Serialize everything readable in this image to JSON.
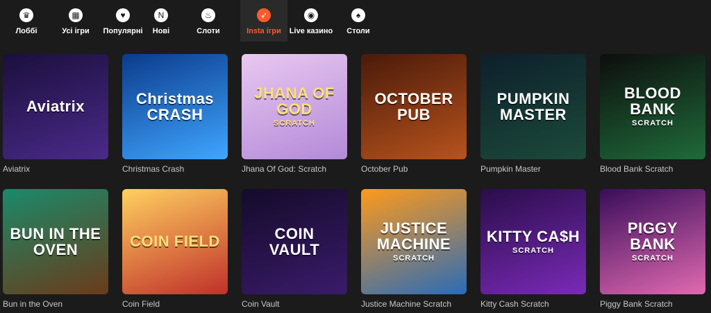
{
  "nav": {
    "items": [
      {
        "label": "Лоббі",
        "icon": "crown-icon",
        "active": false
      },
      {
        "label": "Усі ігри",
        "icon": "grid-icon",
        "active": false
      },
      {
        "label": "Популярні",
        "icon": "heart-icon",
        "active": false
      },
      {
        "label": "Нові",
        "icon": "new-icon",
        "active": false
      },
      {
        "label": "Слоти",
        "icon": "flame-icon",
        "active": false
      },
      {
        "label": "Insta ігри",
        "icon": "rocket-icon",
        "active": true
      },
      {
        "label": "Live казино",
        "icon": "live-icon",
        "active": false
      },
      {
        "label": "Столи",
        "icon": "spade-icon",
        "active": false
      }
    ],
    "active_color": "#ff5a2a"
  },
  "games": [
    {
      "title": "Aviatrix",
      "art": "Aviatrix",
      "art_sub": "",
      "colors": [
        "#1b0f3d",
        "#4a2a8a"
      ]
    },
    {
      "title": "Christmas Crash",
      "art": "Christmas CRASH",
      "art_sub": "",
      "colors": [
        "#0b3b8c",
        "#3fa6ff"
      ]
    },
    {
      "title": "Jhana Of God: Scratch",
      "art": "JHANA OF GOD",
      "art_sub": "SCRATCH",
      "colors": [
        "#e9c8f0",
        "#b28ad8"
      ]
    },
    {
      "title": "October Pub",
      "art": "OCTOBER PUB",
      "art_sub": "",
      "colors": [
        "#4a1a0a",
        "#b8531c"
      ]
    },
    {
      "title": "Pumpkin Master",
      "art": "PUMPKIN MASTER",
      "art_sub": "",
      "colors": [
        "#0d1f2b",
        "#1c4a3a"
      ]
    },
    {
      "title": "Blood Bank Scratch",
      "art": "BLOOD BANK",
      "art_sub": "SCRATCH",
      "colors": [
        "#0d0d0d",
        "#1f6b3a"
      ]
    },
    {
      "title": "Bun in the Oven",
      "art": "BUN IN THE OVEN",
      "art_sub": "",
      "colors": [
        "#1a8a6a",
        "#6a3b1a"
      ]
    },
    {
      "title": "Coin Field",
      "art": "COIN FIELD",
      "art_sub": "",
      "colors": [
        "#ffd060",
        "#c0302a"
      ]
    },
    {
      "title": "Coin Vault",
      "art": "COIN VAULT",
      "art_sub": "",
      "colors": [
        "#140b2a",
        "#3a1b6a"
      ]
    },
    {
      "title": "Justice Machine Scratch",
      "art": "JUSTICE MACHINE",
      "art_sub": "SCRATCH",
      "colors": [
        "#ff9a1a",
        "#2a6bb8"
      ]
    },
    {
      "title": "Kitty Cash Scratch",
      "art": "KITTY CA$H",
      "art_sub": "SCRATCH",
      "colors": [
        "#2a0d4a",
        "#7a2ab8"
      ]
    },
    {
      "title": "Piggy Bank Scratch",
      "art": "PIGGY BANK",
      "art_sub": "SCRATCH",
      "colors": [
        "#3a0d5a",
        "#e06ab0"
      ]
    }
  ]
}
